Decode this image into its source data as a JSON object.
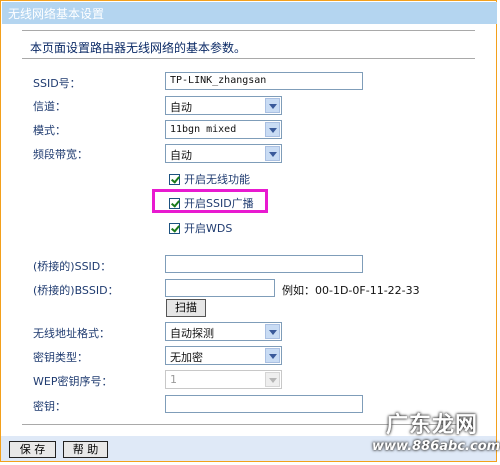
{
  "title": "无线网络基本设置",
  "description": "本页面设置路由器无线网络的基本参数。",
  "fields": {
    "ssid_label": "SSID号：",
    "ssid_value": "TP-LINK_zhangsan",
    "channel_label": "信道：",
    "channel_value": "自动",
    "mode_label": "模式：",
    "mode_value": "11bgn mixed",
    "bandwidth_label": "频段带宽：",
    "bandwidth_value": "自动"
  },
  "checkboxes": {
    "enable_wireless": "开启无线功能",
    "enable_ssid_broadcast": "开启SSID广播",
    "enable_wds": "开启WDS"
  },
  "wds": {
    "bridged_ssid_label": "(桥接的)SSID：",
    "bridged_ssid_value": "",
    "bridged_bssid_label": "(桥接的)BSSID：",
    "bridged_bssid_value": "",
    "example": "例如：00-1D-0F-11-22-33",
    "scan_button": "扫描",
    "address_format_label": "无线地址格式：",
    "address_format_value": "自动探测",
    "key_type_label": "密钥类型：",
    "key_type_value": "无加密",
    "wep_index_label": "WEP密钥序号：",
    "wep_index_value": "1",
    "key_label": "密钥：",
    "key_value": ""
  },
  "footer": {
    "save": "保 存",
    "help": "帮 助"
  },
  "watermark": {
    "text": "广东龙网",
    "url": "www.886abc.com"
  },
  "colors": {
    "titlebar": "#b4d5f0",
    "highlight": "#e81ad0",
    "frame": "#f3a01c"
  }
}
